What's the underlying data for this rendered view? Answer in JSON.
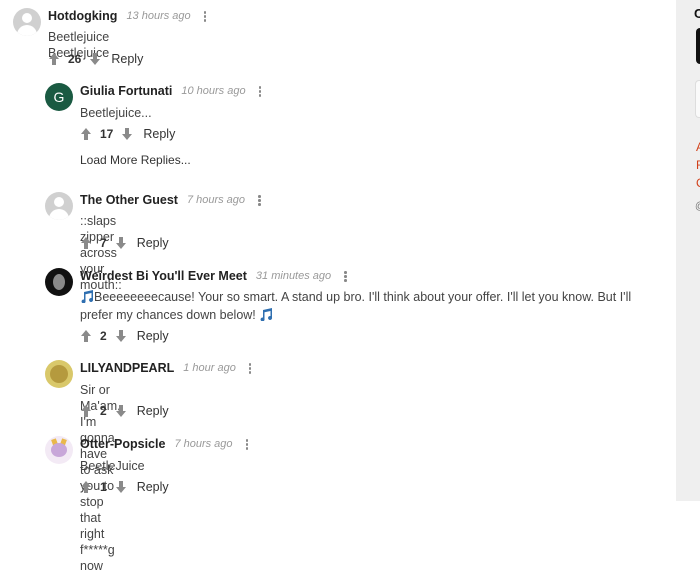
{
  "comments": [
    {
      "author": "Hotdogking",
      "time": "13 hours ago",
      "text": "Beetlejuice Beetlejuice",
      "score": "26",
      "reply": "Reply",
      "avatar": "ghost-avatar"
    },
    {
      "author": "Giulia Fortunati",
      "time": "10 hours ago",
      "text": "Beetlejuice...",
      "score": "17",
      "reply": "Reply",
      "avatar": "letter-avatar",
      "initial": "G"
    },
    {
      "author": "The Other Guest",
      "time": "7 hours ago",
      "text": "::slaps zipper across your mouth::",
      "score": "7",
      "reply": "Reply",
      "avatar": "ghost-avatar"
    },
    {
      "author": "Weirdest Bi You'll Ever Meet",
      "time": "31 minutes ago",
      "text_line1": "Beeeeeeeecause! Your so smart. A stand up bro. I'll think about your offer. I'll let you know. But I'll",
      "text_line2": "prefer my chances down below! ",
      "score": "2",
      "reply": "Reply",
      "avatar": "photo-avatar"
    },
    {
      "author": "LILYANDPEARL",
      "time": "1 hour ago",
      "text": "Sir or Ma'am, I'm gonna have to ask you to stop that right f*****g now",
      "score": "2",
      "reply": "Reply",
      "avatar": "photo-avatar"
    },
    {
      "author": "Otter-Popsicle",
      "time": "7 hours ago",
      "text": "BeetleJuice",
      "score": "1",
      "reply": "Reply",
      "avatar": "illustration-avatar"
    }
  ],
  "load_more": "Load More Replies...",
  "sidebar": {
    "fragment_top": "C",
    "links": [
      "A",
      "F",
      "C"
    ],
    "copyright": "@",
    "link_color": "#d2401a"
  },
  "colors": {
    "letter_avatar": "#1a5a42",
    "arrow": "#8a8a8a",
    "time": "#999999"
  }
}
